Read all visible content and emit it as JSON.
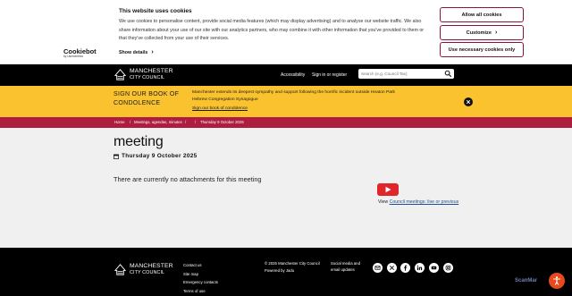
{
  "cookie_banner": {
    "title": "This website uses cookies",
    "text": "We use cookies to personalise content, provide social media features (which may display advertising) and to analyse our website traffic. We also share information about your use of our site with our analytics partners, who may combine it with other information that you've provided to them or that they've collected from your use of their services.",
    "brand": "Cookiebot",
    "brand_sub": "by Usercentrics",
    "show_details": "Show details",
    "allow_all": "Allow all cookies",
    "customize": "Customize",
    "necessary_only": "Use necessary cookies only"
  },
  "header": {
    "logo_line1": "MANCHESTER",
    "logo_line2": "CITY COUNCIL",
    "accessibility": "Accessibility",
    "sign_in": "Sign in or register",
    "search_placeholder": "Search (e.g. Council Tax)"
  },
  "condolence": {
    "title": "SIGN OUR BOOK OF CONDOLENCE",
    "text": "Manchester extends its deepest sympathy and support following the horrific incident outside Heaton Park Hebrew Congregation Synagogue",
    "link": "Sign our book of condolence"
  },
  "breadcrumb": {
    "items": [
      "Home",
      "Meetings, agendas, minutes",
      "",
      "Thursday 9 October 2025"
    ]
  },
  "main": {
    "title": "meeting",
    "date": "Thursday 9 October 2025",
    "no_attachments": "There are currently no attachments for this meeting",
    "view_prefix": "View",
    "view_link": "Council meetings: live or previous"
  },
  "footer": {
    "logo_line1": "MANCHESTER",
    "logo_line2": "CITY COUNCIL",
    "links": [
      "Contact us",
      "Site map",
      "Emergency contacts",
      "Terms of use"
    ],
    "copyright": "© 2025 Manchester City Council",
    "powered": "Powered by Jadu",
    "social_label": "Social media and email updates",
    "social_icons": [
      "email-icon",
      "x-icon",
      "facebook-icon",
      "linkedin-icon",
      "youtube-icon",
      "instagram-icon"
    ]
  },
  "overlay": {
    "scanmarker": "ScanMar"
  },
  "colors": {
    "accent": "#ae1c3f",
    "banner": "#f9c22e",
    "cookie_border": "#8a1538",
    "link": "#1d4f91"
  }
}
